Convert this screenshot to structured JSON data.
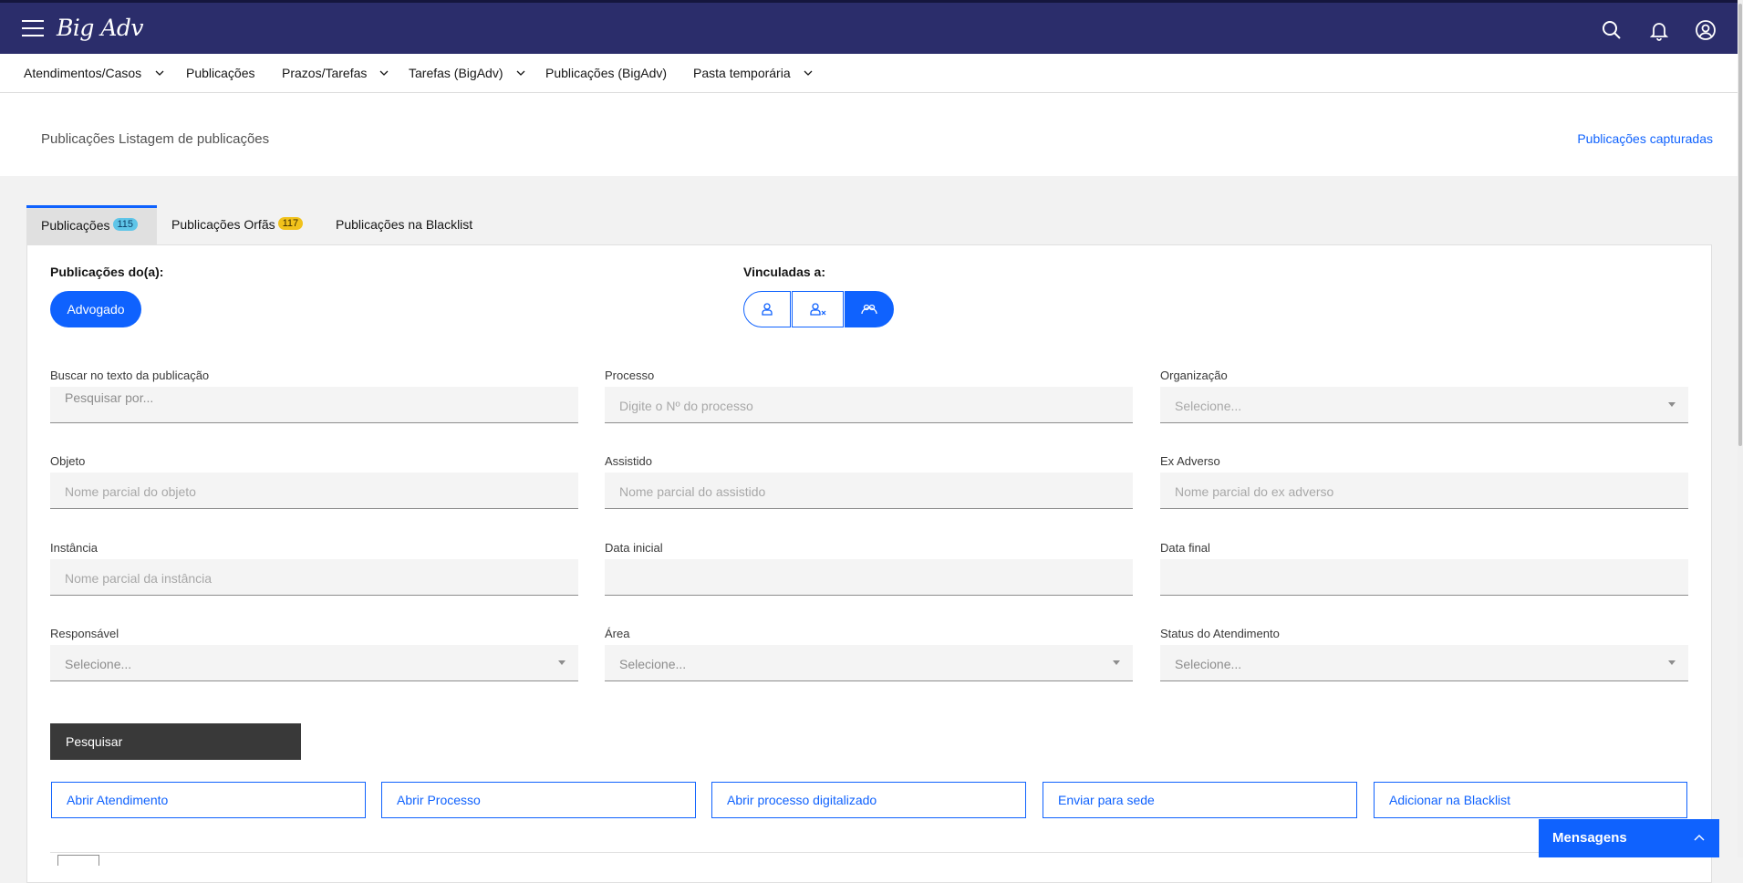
{
  "app": {
    "logo_text": "Big Adv"
  },
  "nav": {
    "items": [
      {
        "label": "Atendimentos/Casos",
        "has_dropdown": true
      },
      {
        "label": "Publicações",
        "has_dropdown": false
      },
      {
        "label": "Prazos/Tarefas",
        "has_dropdown": true
      },
      {
        "label": "Tarefas (BigAdv)",
        "has_dropdown": true
      },
      {
        "label": "Publicações (BigAdv)",
        "has_dropdown": false
      },
      {
        "label": "Pasta temporária",
        "has_dropdown": true
      }
    ]
  },
  "header": {
    "title": "Publicações Listagem de publicações",
    "link": "Publicações capturadas"
  },
  "tabs": [
    {
      "label": "Publicações",
      "badge": "115",
      "active": true
    },
    {
      "label": "Publicações Orfãs",
      "badge": "117",
      "active": false
    },
    {
      "label": "Publicações na Blacklist",
      "badge": "",
      "active": false
    }
  ],
  "filters": {
    "owner_label": "Publicações do(a):",
    "owner_button": "Advogado",
    "linked_label": "Vinculadas a:",
    "fields": {
      "busca": {
        "label": "Buscar no texto da publicação",
        "placeholder": "Pesquisar por..."
      },
      "processo": {
        "label": "Processo",
        "placeholder": "Digite o Nº do processo"
      },
      "organizacao": {
        "label": "Organização",
        "placeholder": "Selecione..."
      },
      "objeto": {
        "label": "Objeto",
        "placeholder": "Nome parcial do objeto"
      },
      "assistido": {
        "label": "Assistido",
        "placeholder": "Nome parcial do assistido"
      },
      "ex_adverso": {
        "label": "Ex Adverso",
        "placeholder": "Nome parcial do ex adverso"
      },
      "instancia": {
        "label": "Instância",
        "placeholder": "Nome parcial da instância"
      },
      "data_inicial": {
        "label": "Data inicial",
        "placeholder": ""
      },
      "data_final": {
        "label": "Data final",
        "placeholder": ""
      },
      "responsavel": {
        "label": "Responsável",
        "placeholder": "Selecione..."
      },
      "area": {
        "label": "Área",
        "placeholder": "Selecione..."
      },
      "status": {
        "label": "Status do Atendimento",
        "placeholder": "Selecione..."
      }
    },
    "search_button": "Pesquisar"
  },
  "actions": [
    "Abrir Atendimento",
    "Abrir Processo",
    "Abrir processo digitalizado",
    "Enviar para sede",
    "Adicionar na Blacklist"
  ],
  "messages": {
    "label": "Mensagens"
  },
  "colors": {
    "topbar": "#2b2d6b",
    "primary": "#0f62fe",
    "dark_button": "#393939",
    "badge_blue": "#5fc5e8",
    "badge_yellow": "#f1c21b"
  }
}
